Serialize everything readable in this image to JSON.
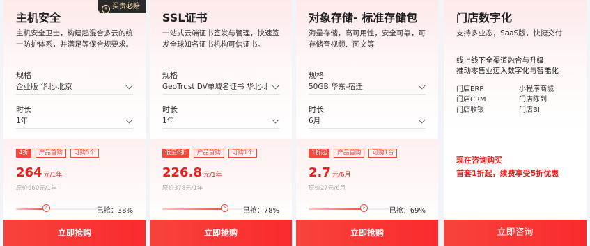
{
  "cards": [
    {
      "title": "主机安全",
      "badge": "买贵必赔",
      "badge_icon": "shield-icon",
      "desc": "主机安全卫士，构建起混合多云的统一防护体系，并满足等保合规要求。",
      "spec_label": "规格",
      "spec_value": "企业版 华北-北京",
      "duration_label": "时长",
      "duration_value": "1年",
      "tags": [
        "4折",
        "产品首购",
        "可购5个"
      ],
      "price": "264",
      "price_unit": "元/1年",
      "original_price": "原价660元/1年",
      "sold_text": "已抢：38%",
      "progress": 0.38,
      "buy_label": "立即抢购"
    },
    {
      "title": "SSL证书",
      "desc": "一站式云端证书签发与管理，快速签发全球知名证书机构可信证书。",
      "spec_label": "规格",
      "spec_value": "GeoTrust DV单域名证书 华北-北京",
      "duration_label": "时长",
      "duration_value": "1年",
      "tags": [
        "低至6折",
        "产品首购",
        "可购1个"
      ],
      "price": "226.8",
      "price_unit": "元/1年",
      "original_price": "原价378元/1年",
      "sold_text": "已抢：78%",
      "progress": 0.78,
      "buy_label": "立即抢购"
    },
    {
      "title": "对象存储- 标准存储包",
      "desc": "海量存储，高可用性，安全可靠，可存储音视频、图文等",
      "spec_label": "规格",
      "spec_value": "50GB 华东-宿迁",
      "duration_label": "时长",
      "duration_value": "6月",
      "tags": [
        "1折起",
        "产品首购",
        "可购1台"
      ],
      "price": "2.7",
      "price_unit": "元/6月",
      "original_price": "原价27元/6月",
      "sold_text": "已抢：69%",
      "progress": 0.69,
      "buy_label": "立即抢购"
    }
  ],
  "retail": {
    "title": "门店数字化",
    "subtitle": "支持多业态，SaaS版，快捷交付",
    "headline1": "线上线下全渠道融合与升级",
    "headline2": "推动零售业迈入数字化与智能化",
    "features": [
      "门店ERP",
      "小程序商城",
      "门店CRM",
      "门店陈列",
      "门店收银",
      "门店BI"
    ],
    "cta1": "现在咨询购买",
    "cta2": "首套1折起，续费享受5折优惠",
    "button_label": "立即咨询"
  },
  "colors": {
    "accent": "#f5483a",
    "price_red": "#e8201b",
    "badge_bg": "#2a2a2a",
    "badge_text": "#ffe7b8"
  }
}
